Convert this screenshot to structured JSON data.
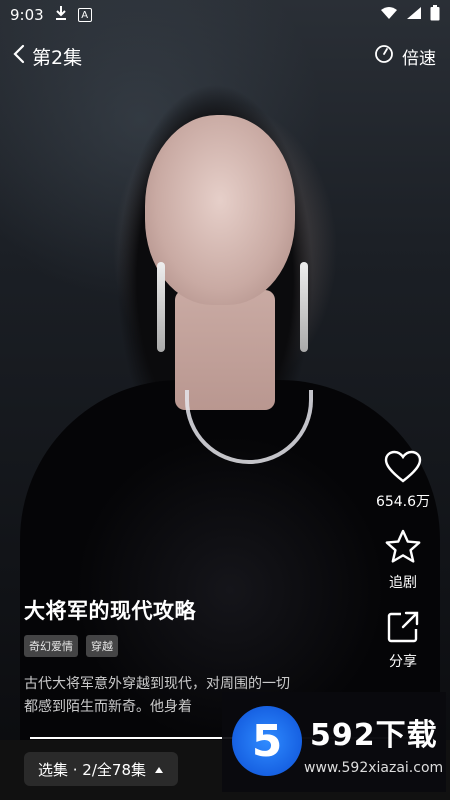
{
  "status_bar": {
    "time": "9:03",
    "icons": [
      "download-icon",
      "a-icon",
      "wifi-icon",
      "signal-icon",
      "battery-icon"
    ]
  },
  "top_bar": {
    "episode_label": "第2集",
    "speed_label": "倍速"
  },
  "rail": {
    "like_count": "654.6万",
    "follow_label": "追剧",
    "share_label": "分享"
  },
  "info": {
    "title": "大将军的现代攻略",
    "tags": [
      "奇幻爱情",
      "穿越"
    ],
    "description_line1": "古代大将军意外穿越到现代，对周围的一切",
    "description_line2": "都感到陌生而新奇。他身着"
  },
  "progress": {
    "fraction": 0.53
  },
  "bottom_bar": {
    "select_label": "选集 · 2/全78集"
  },
  "watermark": {
    "logo_digit": "5",
    "title": "592下载",
    "url": "www.592xiazai.com"
  },
  "colors": {
    "accent_blue": "#1e6fff",
    "background": "#000000"
  }
}
